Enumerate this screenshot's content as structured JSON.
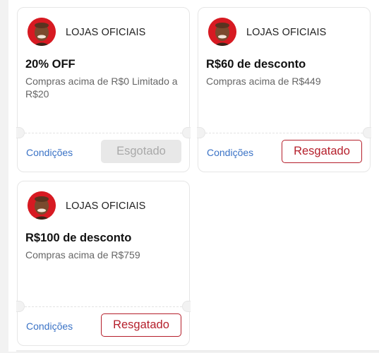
{
  "coupons": [
    {
      "store": "LOJAS OFICIAIS",
      "title": "20% OFF",
      "description": "Compras acima de R$0 Limitado a R$20",
      "conditions_label": "Condições",
      "action_label": "Esgotado",
      "action_state": "sold-out"
    },
    {
      "store": "LOJAS OFICIAIS",
      "title": "R$60 de desconto",
      "description": "Compras acima de R$449",
      "conditions_label": "Condições",
      "action_label": "Resgatado",
      "action_state": "redeemed"
    },
    {
      "store": "LOJAS OFICIAIS",
      "title": "R$100 de desconto",
      "description": "Compras acima de R$759",
      "conditions_label": "Condições",
      "action_label": "Resgatado",
      "action_state": "redeemed"
    }
  ],
  "colors": {
    "accent_red": "#b51f2b",
    "link_blue": "#3b73c6",
    "avatar_bg": "#d71a22"
  }
}
